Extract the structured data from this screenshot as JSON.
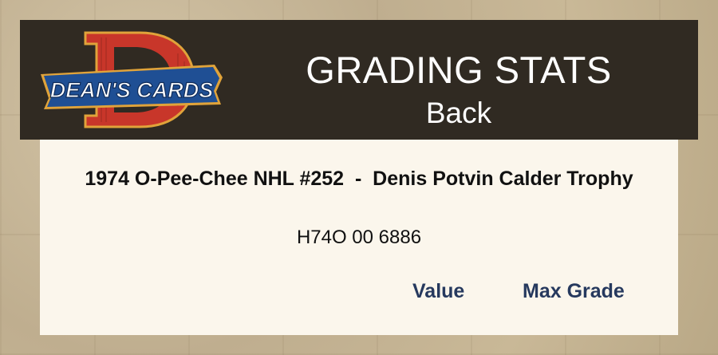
{
  "header": {
    "logo_text": "DEAN'S CARDS",
    "title": "GRADING STATS",
    "subtitle": "Back"
  },
  "card": {
    "title": "1974 O-Pee-Chee NHL #252  -  Denis Potvin Calder Trophy",
    "cert_number": "H74O 00 6886"
  },
  "columns": {
    "value_label": "Value",
    "max_grade_label": "Max Grade"
  },
  "colors": {
    "header_bg": "#302a22",
    "card_bg": "#fbf6ec",
    "column_header": "#26395e",
    "logo_red": "#c8362a",
    "logo_blue": "#1f4f94"
  }
}
